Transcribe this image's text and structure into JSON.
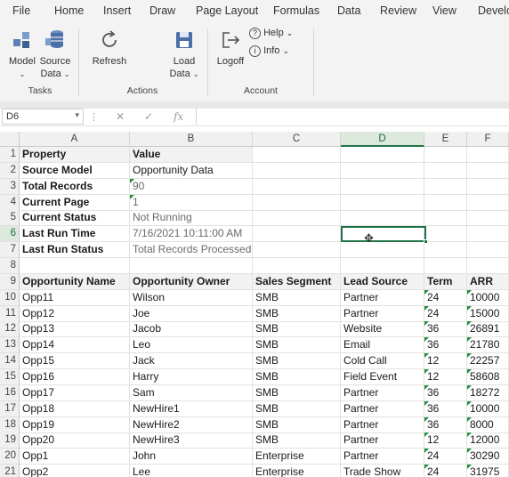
{
  "menu": [
    "File",
    "Home",
    "Insert",
    "Draw",
    "Page Layout",
    "Formulas",
    "Data",
    "Review",
    "View",
    "Develo"
  ],
  "ribbon": {
    "model_label": "Model",
    "source_data_label": "Source",
    "source_data_label2": "Data",
    "refresh_label": "Refresh",
    "load_data_label": "Load",
    "load_data_label2": "Data",
    "logoff_label": "Logoff",
    "help_label": "Help",
    "info_label": "Info",
    "groups": [
      "Tasks",
      "Actions",
      "Account"
    ]
  },
  "formula_bar": {
    "name_box": "D6",
    "fx": "fx",
    "cancel": "✕",
    "enter": "✓",
    "formula": ""
  },
  "columns": [
    "A",
    "B",
    "C",
    "D",
    "E",
    "F"
  ],
  "rows": [
    {
      "n": "1",
      "a": "Property",
      "b": "Value"
    },
    {
      "n": "2",
      "a": "Source Model",
      "b": "Opportunity Data"
    },
    {
      "n": "3",
      "a": "Total Records",
      "b": "90"
    },
    {
      "n": "4",
      "a": "Current Page",
      "b": "1"
    },
    {
      "n": "5",
      "a": "Current Status",
      "b": "Not Running"
    },
    {
      "n": "6",
      "a": "Last Run Time",
      "b": "7/16/2021 10:11:00 AM"
    },
    {
      "n": "7",
      "a": "Last Run Status",
      "b": "Total Records Processed:"
    },
    {
      "n": "8"
    }
  ],
  "table": {
    "headers": [
      "Opportunity Name",
      "Opportunity Owner",
      "Sales Segment",
      "Lead Source",
      "Term",
      "ARR"
    ],
    "rows": [
      {
        "n": "10",
        "c": [
          "Opp11",
          "Wilson",
          "SMB",
          "Partner",
          "24",
          "10000"
        ]
      },
      {
        "n": "11",
        "c": [
          "Opp12",
          "Joe",
          "SMB",
          "Partner",
          "24",
          "15000"
        ]
      },
      {
        "n": "12",
        "c": [
          "Opp13",
          "Jacob",
          "SMB",
          "Website",
          "36",
          "26891"
        ]
      },
      {
        "n": "13",
        "c": [
          "Opp14",
          "Leo",
          "SMB",
          "Email",
          "36",
          "21780"
        ]
      },
      {
        "n": "14",
        "c": [
          "Opp15",
          "Jack",
          "SMB",
          "Cold Call",
          "12",
          "22257"
        ]
      },
      {
        "n": "15",
        "c": [
          "Opp16",
          "Harry",
          "SMB",
          "Field Event",
          "12",
          "58608"
        ]
      },
      {
        "n": "16",
        "c": [
          "Opp17",
          "Sam",
          "SMB",
          "Partner",
          "36",
          "18272"
        ]
      },
      {
        "n": "17",
        "c": [
          "Opp18",
          "NewHire1",
          "SMB",
          "Partner",
          "36",
          "10000"
        ]
      },
      {
        "n": "18",
        "c": [
          "Opp19",
          "NewHire2",
          "SMB",
          "Partner",
          "36",
          "8000"
        ]
      },
      {
        "n": "19",
        "c": [
          "Opp20",
          "NewHire3",
          "SMB",
          "Partner",
          "12",
          "12000"
        ]
      },
      {
        "n": "20",
        "c": [
          "Opp1",
          "John",
          "Enterprise",
          "Partner",
          "24",
          "30290"
        ]
      },
      {
        "n": "21",
        "c": [
          "Opp2",
          "Lee",
          "Enterprise",
          "Trade Show",
          "24",
          "31975"
        ]
      }
    ]
  }
}
